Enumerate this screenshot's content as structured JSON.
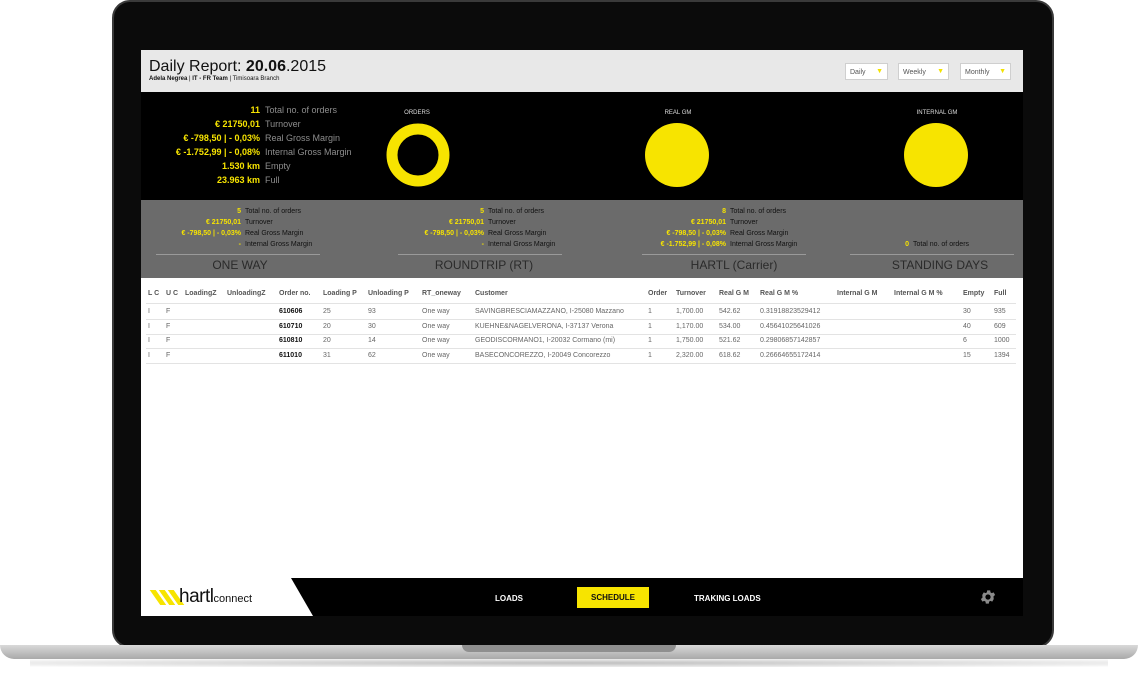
{
  "header": {
    "title_prefix": "Daily Report: ",
    "title_bold": "20.06",
    "title_suffix": ".2015",
    "user": "Adela Negrea",
    "team": "IT - FR Team",
    "branch": "Timisoara Branch",
    "separator": " | ",
    "periods": [
      "Daily",
      "Weekly",
      "Monthly"
    ]
  },
  "summary": {
    "rows": [
      {
        "value": "11",
        "label": "Total no. of orders"
      },
      {
        "value": "€ 21750,01",
        "label": "Turnover"
      },
      {
        "value": "€ -798,50 | - 0,03%",
        "label": "Real Gross Margin"
      },
      {
        "value": "€ -1.752,99 | - 0,08%",
        "label": "Internal Gross Margin"
      },
      {
        "value": "1.530 km",
        "label": "Empty"
      },
      {
        "value": "23.963 km",
        "label": "Full"
      }
    ],
    "circles": [
      {
        "label": "ORDERS",
        "style": "ring"
      },
      {
        "label": "REAL GM",
        "style": "disc"
      },
      {
        "label": "INTERNAL GM",
        "style": "disc"
      }
    ],
    "accent_color": "#f7e400"
  },
  "segments": [
    {
      "title": "ONE WAY",
      "rows": [
        {
          "value": "5",
          "label": "Total no. of orders"
        },
        {
          "value": "€ 21750,01",
          "label": "Turnover"
        },
        {
          "value": "€ -798,50 | - 0,03%",
          "label": "Real Gross Margin"
        },
        {
          "value": "-",
          "label": "Internal Gross Margin"
        }
      ]
    },
    {
      "title": "ROUNDTRIP (RT)",
      "rows": [
        {
          "value": "5",
          "label": "Total no. of orders"
        },
        {
          "value": "€ 21750,01",
          "label": "Turnover"
        },
        {
          "value": "€ -798,50 | - 0,03%",
          "label": "Real Gross Margin"
        },
        {
          "value": "-",
          "label": "Internal Gross Margin"
        }
      ]
    },
    {
      "title": "HARTL (Carrier)",
      "rows": [
        {
          "value": "8",
          "label": "Total no. of orders"
        },
        {
          "value": "€ 21750,01",
          "label": "Turnover"
        },
        {
          "value": "€ -798,50 | - 0,03%",
          "label": "Real Gross Margin"
        },
        {
          "value": "€ -1.752,99 | - 0,08%",
          "label": "Internal Gross Margin"
        }
      ]
    },
    {
      "title": "STANDING DAYS",
      "rows": [
        {
          "value": "0",
          "label": "Total no. of orders"
        }
      ]
    }
  ],
  "table": {
    "headers": [
      "L C",
      "U C",
      "LoadingZ",
      "UnloadingZ",
      "Order no.",
      "Loading P",
      "Unloading P",
      "RT_oneway",
      "Customer",
      "Order",
      "Turnover",
      "Real G M",
      "Real G M %",
      "Internal G M",
      "Internal G M %",
      "Empty",
      "Full"
    ],
    "rows": [
      [
        "I",
        "F",
        "",
        "",
        "610606",
        "25",
        "93",
        "One way",
        "SAVINGBRESCIAMAZZANO, I-25080 Mazzano",
        "1",
        "1,700.00",
        "542.62",
        "0.31918823529412",
        "",
        "",
        "30",
        "935"
      ],
      [
        "I",
        "F",
        "",
        "",
        "610710",
        "20",
        "30",
        "One way",
        "KUEHNE&NAGELVERONA, I-37137 Verona",
        "1",
        "1,170.00",
        "534.00",
        "0.45641025641026",
        "",
        "",
        "40",
        "609"
      ],
      [
        "I",
        "F",
        "",
        "",
        "610810",
        "20",
        "14",
        "One way",
        "GEODISCORMANO1, I-20032 Cormano (mi)",
        "1",
        "1,750.00",
        "521.62",
        "0.29806857142857",
        "",
        "",
        "6",
        "1000"
      ],
      [
        "I",
        "F",
        "",
        "",
        "611010",
        "31",
        "62",
        "One way",
        "BASECONCOREZZO, I-20049 Concorezzo",
        "1",
        "2,320.00",
        "618.62",
        "0.26664655172414",
        "",
        "",
        "15",
        "1394"
      ]
    ]
  },
  "footer": {
    "logo_main": "hartl",
    "logo_sub": "connect",
    "nav": [
      "LOADS",
      "SCHEDULE",
      "TRAKING LOADS"
    ],
    "active_nav": "SCHEDULE",
    "settings_icon": "gear-icon"
  }
}
